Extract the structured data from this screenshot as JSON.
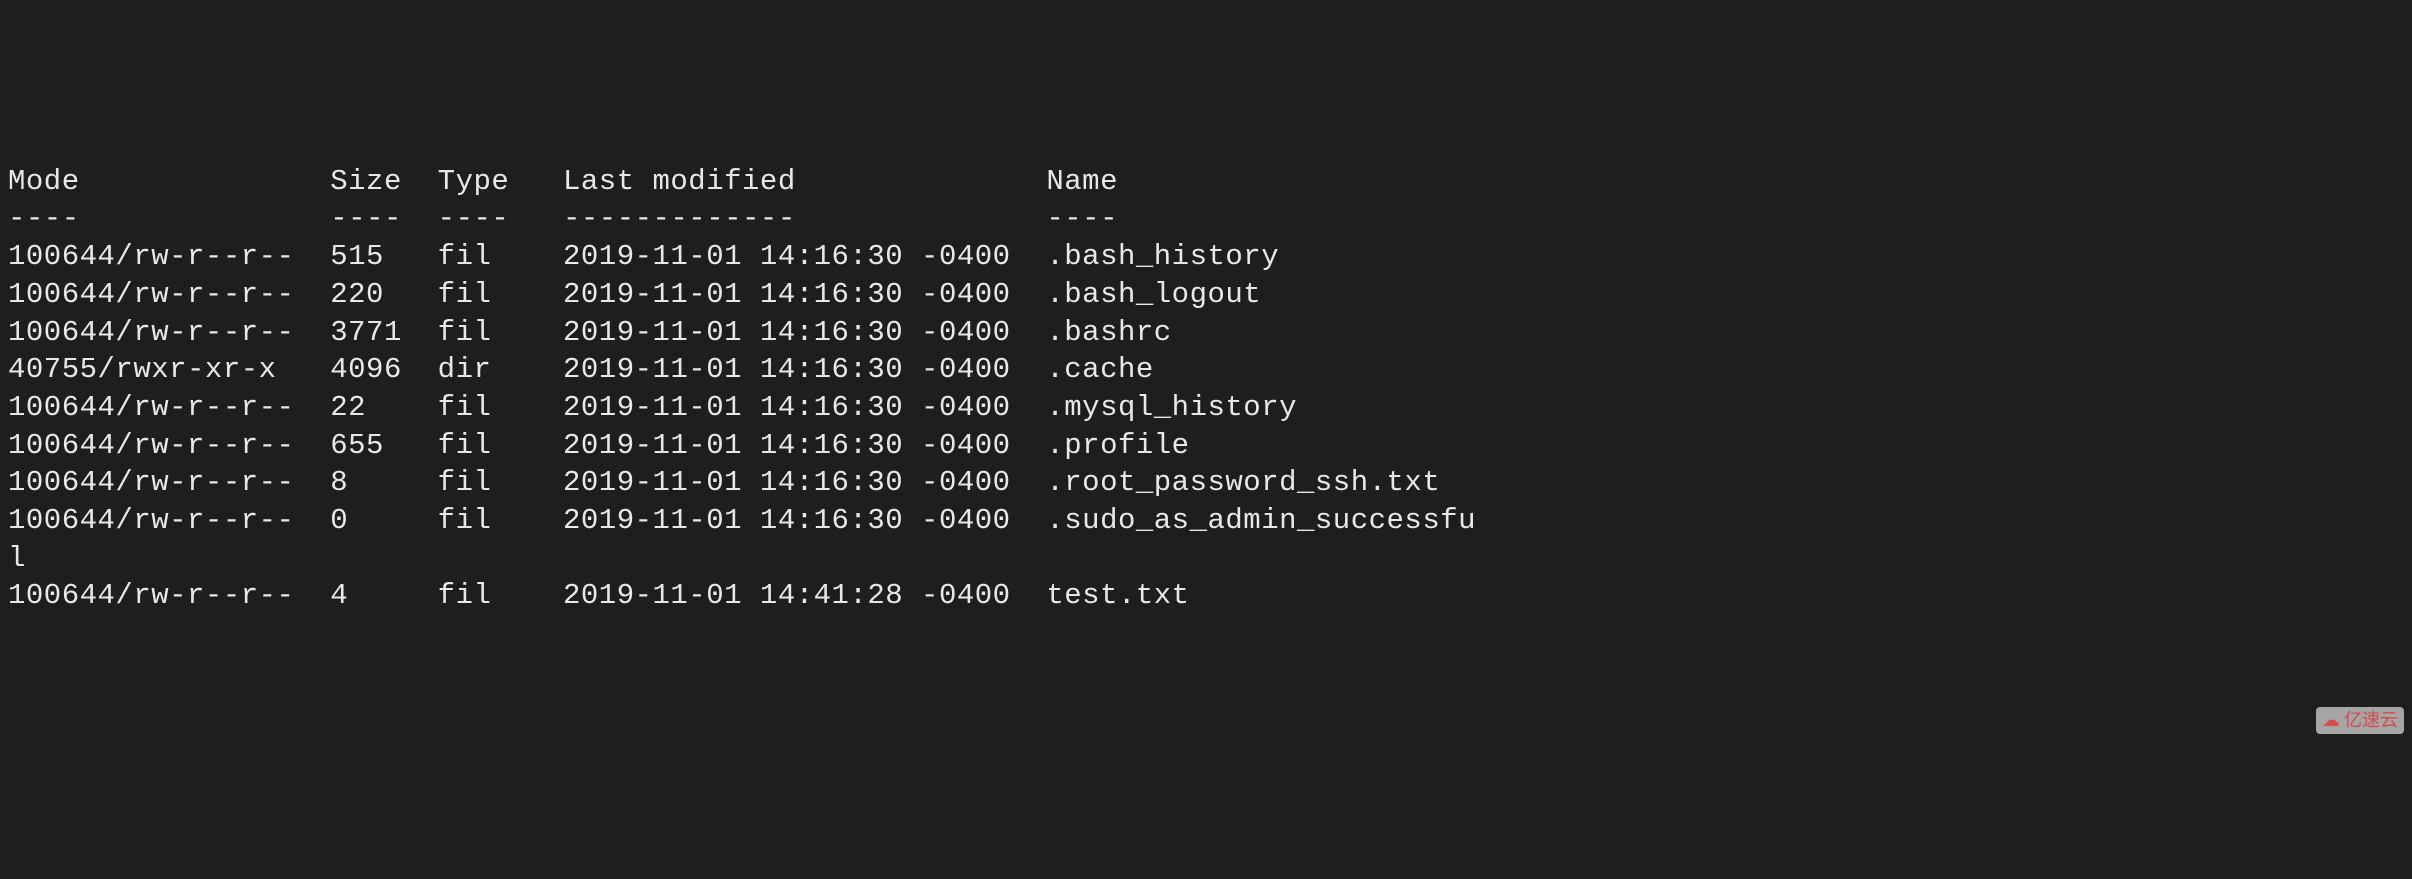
{
  "listing": {
    "headers": {
      "mode": "Mode",
      "size": "Size",
      "type": "Type",
      "last_modified": "Last modified",
      "name": "Name"
    },
    "dividers": {
      "mode": "----",
      "size": "----",
      "type": "----",
      "last_modified": "-------------",
      "name": "----"
    },
    "rows": [
      {
        "mode": "100644/rw-r--r--",
        "size": "515",
        "type": "fil",
        "last_modified": "2019-11-01 14:16:30 -0400",
        "name": ".bash_history"
      },
      {
        "mode": "100644/rw-r--r--",
        "size": "220",
        "type": "fil",
        "last_modified": "2019-11-01 14:16:30 -0400",
        "name": ".bash_logout"
      },
      {
        "mode": "100644/rw-r--r--",
        "size": "3771",
        "type": "fil",
        "last_modified": "2019-11-01 14:16:30 -0400",
        "name": ".bashrc"
      },
      {
        "mode": "40755/rwxr-xr-x",
        "size": "4096",
        "type": "dir",
        "last_modified": "2019-11-01 14:16:30 -0400",
        "name": ".cache"
      },
      {
        "mode": "100644/rw-r--r--",
        "size": "22",
        "type": "fil",
        "last_modified": "2019-11-01 14:16:30 -0400",
        "name": ".mysql_history"
      },
      {
        "mode": "100644/rw-r--r--",
        "size": "655",
        "type": "fil",
        "last_modified": "2019-11-01 14:16:30 -0400",
        "name": ".profile"
      },
      {
        "mode": "100644/rw-r--r--",
        "size": "8",
        "type": "fil",
        "last_modified": "2019-11-01 14:16:30 -0400",
        "name": ".root_password_ssh.txt"
      },
      {
        "mode": "100644/rw-r--r--",
        "size": "0",
        "type": "fil",
        "last_modified": "2019-11-01 14:16:30 -0400",
        "name": ".sudo_as_admin_successful"
      },
      {
        "mode": "100644/rw-r--r--",
        "size": "4",
        "type": "fil",
        "last_modified": "2019-11-01 14:41:28 -0400",
        "name": "test.txt"
      }
    ]
  },
  "watermark": {
    "text": "亿速云",
    "icon": "☁"
  },
  "cols": {
    "mode": 18,
    "size": 6,
    "type": 7,
    "last_modified": 27,
    "name": 0
  }
}
